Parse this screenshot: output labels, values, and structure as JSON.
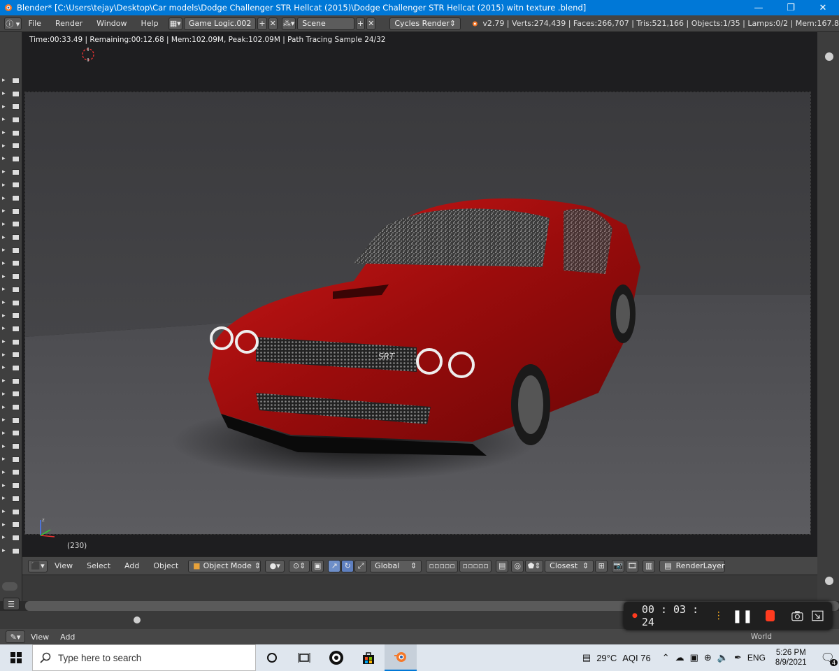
{
  "window": {
    "title": "Blender* [C:\\Users\\tejay\\Desktop\\Car models\\Dodge Challenger STR Hellcat (2015)\\Dodge Challenger STR Hellcat (2015) witn texture .blend]"
  },
  "info_bar": {
    "menus": [
      "File",
      "Render",
      "Window",
      "Help"
    ],
    "screen_layout": "Game Logic.002",
    "scene": "Scene",
    "render_engine": "Cycles Render",
    "stats": "v2.79 | Verts:274,439 | Faces:266,707 | Tris:521,166 | Objects:1/35 | Lamps:0/2 | Mem:167.8"
  },
  "viewport": {
    "render_status": "Time:00:33.49 | Remaining:00:12.68 | Mem:102.09M, Peak:102.09M | Path Tracing Sample 24/32",
    "frame_number": "(230)",
    "badge_text": "SRT"
  },
  "view3d_header": {
    "menus": [
      "View",
      "Select",
      "Add",
      "Object"
    ],
    "mode": "Object Mode",
    "orientation": "Global",
    "snap_target": "Closest",
    "render_layer": "RenderLayer"
  },
  "lower_editor": {
    "menus": [
      "View",
      "Add"
    ],
    "world_label": "World"
  },
  "recorder": {
    "time": "00 : 03 : 24"
  },
  "taskbar": {
    "search_placeholder": "Type here to search",
    "temperature": "29°C",
    "aqi": "AQI 76",
    "language": "ENG",
    "time": "5:26 PM",
    "date": "8/9/2021",
    "notification_count": "4"
  },
  "colors": {
    "titlebar": "#0078d7",
    "car_red": "#b01010",
    "record_red": "#ff3b1f"
  }
}
